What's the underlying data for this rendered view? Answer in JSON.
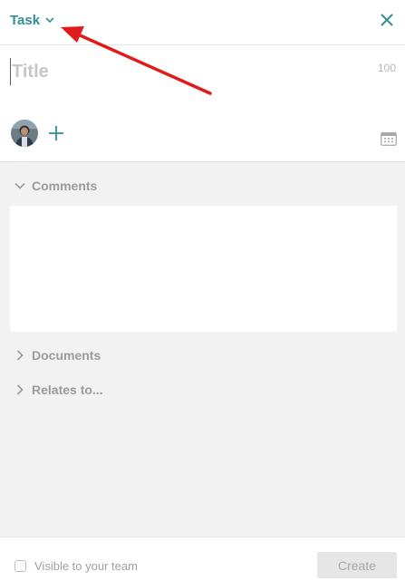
{
  "header": {
    "type_label": "Task"
  },
  "title_field": {
    "placeholder": "Title",
    "value": "",
    "char_limit": "100"
  },
  "sections": [
    {
      "label": "Comments",
      "expanded": true
    },
    {
      "label": "Documents",
      "expanded": false
    },
    {
      "label": "Relates to...",
      "expanded": false
    }
  ],
  "footer": {
    "visibility_label": "Visible to your team",
    "visibility_checked": false,
    "create_label": "Create"
  },
  "icons": {
    "type_dropdown": "chevron-down-icon",
    "close": "close-icon",
    "add_assignee": "plus-icon",
    "calendar": "calendar-icon",
    "section_expanded": "chevron-down-icon",
    "section_collapsed": "chevron-right-icon"
  },
  "colors": {
    "accent": "#2f8f94",
    "panel_background": "#f2f2f2",
    "muted_text": "#9b9b9b",
    "annotation_arrow": "#e01b1b"
  }
}
